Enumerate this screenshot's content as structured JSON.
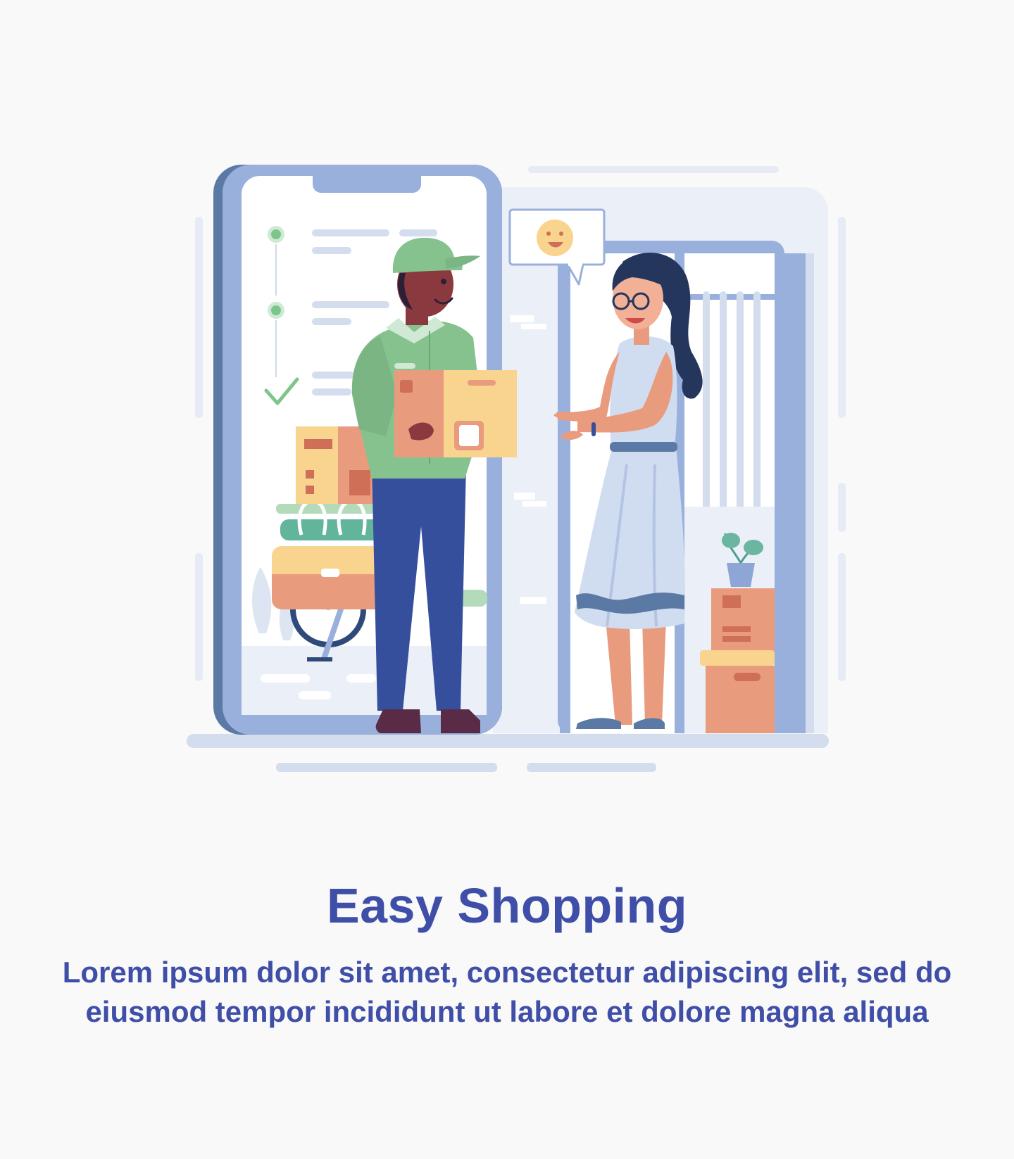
{
  "onboarding": {
    "title": "Easy Shopping",
    "description": "Lorem ipsum dolor sit amet, consectetur adipiscing elit, sed do eiusmod tempor incididunt ut labore et dolore magna aliqua"
  },
  "illustration": {
    "icon": "delivery-handover-illustration",
    "colors": {
      "phone_frame": "#9ab0dc",
      "phone_frame_dark": "#5b79a5",
      "screen": "#ffffff",
      "check_green": "#7cc68a",
      "uniform_green": "#86c28e",
      "pants_blue": "#354f9c",
      "box_orange": "#e99b7e",
      "box_yellow": "#f8d48f",
      "dress_light": "#d0dcf0",
      "dress_band": "#5b79a5",
      "text_blue": "#3f4ea7"
    }
  }
}
